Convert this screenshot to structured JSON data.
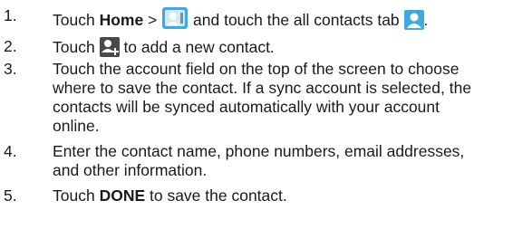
{
  "steps": [
    {
      "num": "1.",
      "pre": "Touch ",
      "home": "Home",
      "gt": " > ",
      "mid": " and touch the all contacts tab ",
      "end": ".",
      "icons": [
        "contacts-app-icon",
        "all-contacts-tab-icon"
      ]
    },
    {
      "num": "2.",
      "pre": "Touch ",
      "post": " to add a new contact.",
      "icons": [
        "add-contact-icon"
      ]
    },
    {
      "num": "3.",
      "lines": [
        "Touch the account field on the top of the screen to choose",
        "where to save the contact. If a sync account is selected, the",
        "contacts will be synced automatically with your account",
        "online."
      ]
    },
    {
      "num": "4.",
      "lines": [
        "Enter the contact name, phone numbers, email addresses,",
        "and other information."
      ]
    },
    {
      "num": "5.",
      "pre": "Touch ",
      "done": "DONE",
      "post": " to save the contact."
    }
  ],
  "colors": {
    "text": "#1a1a1a",
    "icon_blue": "#3fa9e0",
    "icon_dark": "#4a4a4a"
  }
}
